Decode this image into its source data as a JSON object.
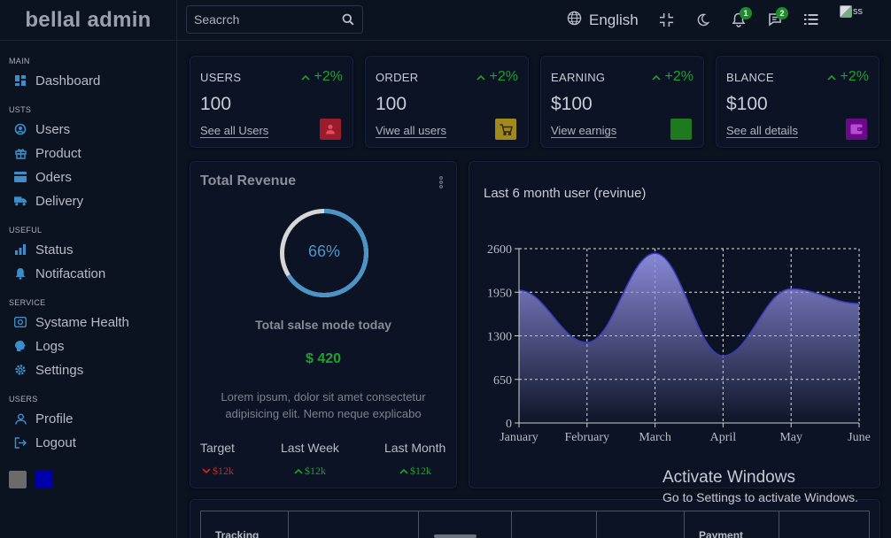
{
  "app": {
    "brand": "bellal admin"
  },
  "topbar": {
    "search_placeholder": "Seacrch",
    "language": "English",
    "notifications_count": "1",
    "messages_count": "2",
    "avatar_alt": "ss",
    "icons": [
      "search-icon",
      "globe-icon",
      "fullscreen-exit-icon",
      "moon-icon",
      "bell-icon",
      "chat-icon",
      "list-icon"
    ]
  },
  "sidebar": {
    "sections": [
      {
        "title": "MAIN",
        "items": [
          {
            "label": "Dashboard",
            "icon": "dashboard-icon"
          }
        ]
      },
      {
        "title": "USTS",
        "items": [
          {
            "label": "Users",
            "icon": "users-icon"
          },
          {
            "label": "Product",
            "icon": "gift-icon"
          },
          {
            "label": "Oders",
            "icon": "card-icon"
          },
          {
            "label": "Delivery",
            "icon": "truck-icon"
          }
        ]
      },
      {
        "title": "USEFUL",
        "items": [
          {
            "label": "Status",
            "icon": "bar-chart-icon"
          },
          {
            "label": "Notifacation",
            "icon": "bell-icon"
          }
        ]
      },
      {
        "title": "SERVICE",
        "items": [
          {
            "label": "Systame Health",
            "icon": "health-icon"
          },
          {
            "label": "Logs",
            "icon": "brain-icon"
          },
          {
            "label": "Settings",
            "icon": "gear-icon"
          }
        ]
      },
      {
        "title": "USERS",
        "items": [
          {
            "label": "Profile",
            "icon": "profile-icon"
          },
          {
            "label": "Logout",
            "icon": "logout-icon"
          }
        ]
      }
    ],
    "themes": [
      {
        "name": "gray",
        "color": "#6b6b6b"
      },
      {
        "name": "blue",
        "color": "#0000aa"
      }
    ]
  },
  "stats": [
    {
      "title": "USERS",
      "percent": "+2%",
      "value": "100",
      "link": "See all Users",
      "icon": "person-icon",
      "color": "#9b1c2c"
    },
    {
      "title": "ORDER",
      "percent": "+2%",
      "value": "100",
      "link": "Viwe all users",
      "icon": "cart-icon",
      "color": "#a08a1e"
    },
    {
      "title": "EARNING",
      "percent": "+2%",
      "value": "$100",
      "link": "View earnigs",
      "icon": "money-icon",
      "color": "#1f7a1f"
    },
    {
      "title": "BLANCE",
      "percent": "+2%",
      "value": "$100",
      "link": "See all details",
      "icon": "wallet-icon",
      "color": "#6a0a8a"
    }
  ],
  "revenue": {
    "title": "Total Revenue",
    "progress": 0.66,
    "progress_label": "66%",
    "subtitle": "Total salse mode today",
    "amount": "$ 420",
    "description": "Lorem ipsum, dolor sit amet consectetur adipisicing elit. Nemo neque explicabo",
    "columns": [
      {
        "label": "Target",
        "value": "$12k",
        "trend": "down",
        "color": "#e0201e"
      },
      {
        "label": "Last Week",
        "value": "$12k",
        "trend": "up",
        "color": "#1ea12d"
      },
      {
        "label": "Last Month",
        "value": "$12k",
        "trend": "up",
        "color": "#1ea12d"
      }
    ]
  },
  "chart_data": {
    "type": "area",
    "title": "Last 6 month user (revinue)",
    "categories": [
      "January",
      "February",
      "March",
      "April",
      "May",
      "June"
    ],
    "values": [
      1980,
      1200,
      2530,
      1000,
      2000,
      1780
    ],
    "ylim": [
      0,
      2600
    ],
    "yticks": [
      0,
      650,
      1300,
      1950,
      2600
    ],
    "grid": true,
    "colors": {
      "fill": "#8e8ee0",
      "stroke": "#3b3bbf"
    }
  },
  "table": {
    "headers": [
      "Tracking",
      "",
      "",
      "",
      "",
      "Payment",
      ""
    ]
  },
  "windows_notice": {
    "title": "Activate Windows",
    "subtitle": "Go to Settings to activate Windows."
  }
}
